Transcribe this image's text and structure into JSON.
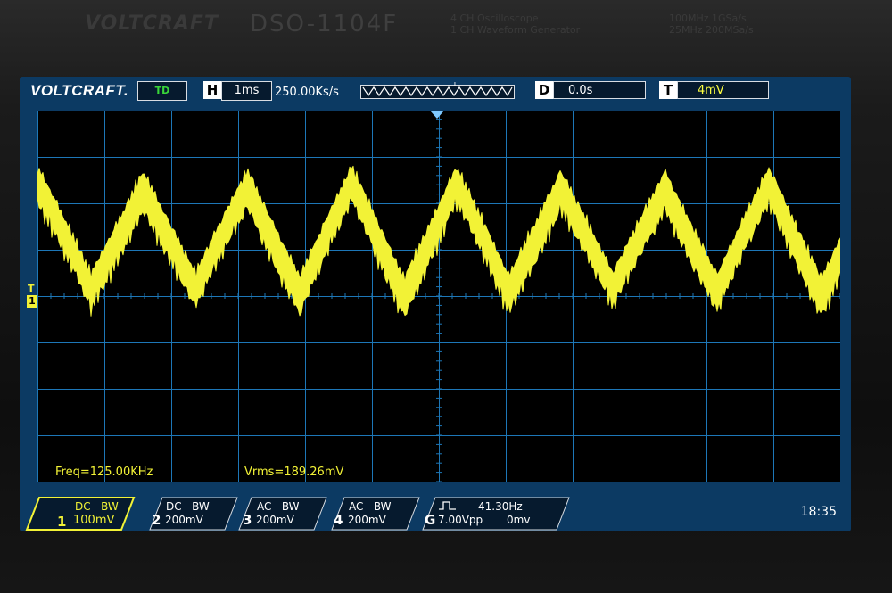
{
  "bezel": {
    "brand": "VOLTCRAFT",
    "model": "DSO-1104F",
    "spec_line1": "4 CH Oscilloscope",
    "spec_line2": "1 CH Waveform Generator",
    "spec_line3": "100MHz 1GSa/s",
    "spec_line4": "25MHz 200MSa/s"
  },
  "screen": {
    "logo": "VOLTCRAFT.",
    "mode": "TD",
    "timebase_tag": "H",
    "timebase": "1ms",
    "sample_rate": "250.00Ks/s",
    "trigger_pos_marker": "T",
    "delay_tag": "D",
    "delay": "0.0s",
    "trigger_tag": "T",
    "trigger_level": "4mV",
    "channel1_marker": "1",
    "trigger_level_marker": "T"
  },
  "measurements": {
    "freq": "Freq=125.00KHz",
    "vrms": "Vrms=189.26mV"
  },
  "channels": [
    {
      "num": "1",
      "coupling": "DC",
      "bw": "BW",
      "scale": "100mV",
      "active": true
    },
    {
      "num": "2",
      "coupling": "DC",
      "bw": "BW",
      "scale": "200mV",
      "active": false
    },
    {
      "num": "3",
      "coupling": "AC",
      "bw": "BW",
      "scale": "200mV",
      "active": false
    },
    {
      "num": "4",
      "coupling": "AC",
      "bw": "BW",
      "scale": "200mV",
      "active": false
    }
  ],
  "generator": {
    "tag": "G",
    "wave_icon": "square-wave-icon",
    "frequency": "41.30Hz",
    "amplitude": "7.00Vpp",
    "offset": "0mv"
  },
  "clock": "18:35",
  "colors": {
    "screen_bg": "#0c3a63",
    "plot_bg": "#000000",
    "grid": "#1d77b7",
    "trace": "#f2f236",
    "mode": "#39d639"
  }
}
